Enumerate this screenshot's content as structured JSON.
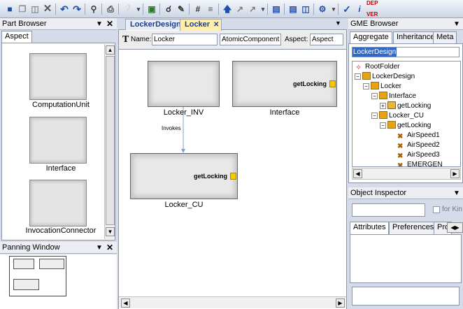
{
  "toolbar": {
    "icons": [
      "save-icon",
      "copy-icon",
      "paste-icon",
      "delete-icon",
      "undo-icon",
      "redo-icon",
      "find-icon",
      "print-icon",
      "help-icon",
      "more-icon",
      "show-ports-icon",
      "zoom-icon",
      "edit-icon",
      "grid-icon",
      "connection-icon",
      "arrow-up-icon",
      "move-icon",
      "move-icon-2",
      "more-icon-2",
      "window-icon",
      "window-icon-2",
      "split-icon",
      "constraint-icon",
      "more-icon-3",
      "check-icon",
      "interpreter-icon",
      "dep-ver-icon"
    ],
    "dep_ver_label": "DEP VER"
  },
  "part_browser": {
    "title": "Part Browser",
    "tab": "Aspect",
    "items": [
      {
        "label": "ComputationUnit"
      },
      {
        "label": "Interface"
      },
      {
        "label": "InvocationConnector"
      }
    ]
  },
  "panning_window": {
    "title": "Panning Window"
  },
  "editor": {
    "tabs": [
      {
        "label": "LockerDesign"
      },
      {
        "label": "Locker"
      }
    ],
    "name_label": "Name:",
    "name_value": "Locker",
    "kind_value": "AtomicComponent",
    "aspect_label": "Aspect:",
    "aspect_value": "Aspect",
    "models": [
      {
        "name": "Locker_INV",
        "port": ""
      },
      {
        "name": "Interface",
        "port": "getLocking"
      },
      {
        "name": "Locker_CU",
        "port": "getLocking"
      }
    ],
    "connection_label": "Invokes"
  },
  "gme_browser": {
    "title": "GME Browser",
    "tabs": [
      "Aggregate",
      "Inheritance",
      "Meta"
    ],
    "search_value": "LockerDesign",
    "tree": [
      {
        "label": "RootFolder"
      },
      {
        "label": "LockerDesign"
      },
      {
        "label": "Locker"
      },
      {
        "label": "Interface"
      },
      {
        "label": "getLocking"
      },
      {
        "label": "Locker_CU"
      },
      {
        "label": "getLocking"
      },
      {
        "label": "AirSpeed1"
      },
      {
        "label": "AirSpeed2"
      },
      {
        "label": "AirSpeed3"
      },
      {
        "label": "EMERGEN"
      }
    ]
  },
  "object_inspector": {
    "title": "Object Inspector",
    "for_kind_label": "for Kin",
    "tabs": [
      "Attributes",
      "Preferences",
      "Pro"
    ]
  },
  "colors": {
    "port": "#f5c800",
    "folder": "#e6a316",
    "selection": "#316ac5",
    "connection": "#7da0d8"
  }
}
